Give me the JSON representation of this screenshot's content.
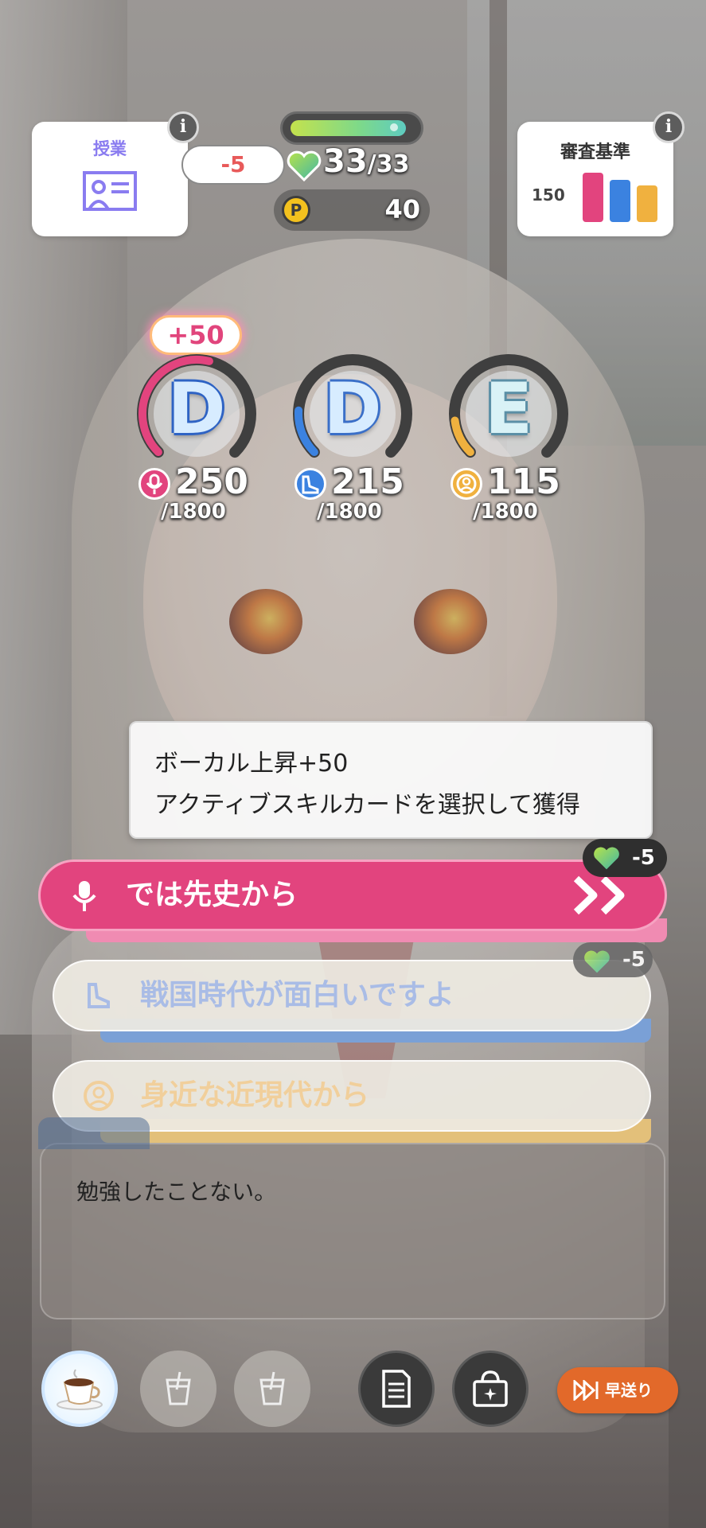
{
  "lesson": {
    "title": "授業",
    "icon": "teacher-board-icon"
  },
  "criteria": {
    "title": "審査基準",
    "value": "150",
    "bars": [
      {
        "color": "#e2447e",
        "level": 1.0
      },
      {
        "color": "#3b82e0",
        "level": 0.86
      },
      {
        "color": "#f0b13f",
        "level": 0.74
      }
    ]
  },
  "stamina": {
    "delta": "-5",
    "current": "33",
    "separator": "/",
    "max": "33",
    "fill_fraction": 0.94
  },
  "p_points": {
    "symbol": "P",
    "value": "40"
  },
  "stats": [
    {
      "grade": "D",
      "value": "250",
      "max": "/1800",
      "color": "#e2447e",
      "icon": "microphone-icon",
      "fill_fraction": 0.55
    },
    {
      "grade": "D",
      "value": "215",
      "max": "/1800",
      "color": "#3b82e0",
      "icon": "dance-shoe-icon",
      "fill_fraction": 0.18
    },
    {
      "grade": "E",
      "value": "115",
      "max": "/1800",
      "color": "#f0b13f",
      "icon": "visual-face-icon",
      "fill_fraction": 0.14
    }
  ],
  "stat_bonus": "+50",
  "tooltip": {
    "line1": "ボーカル上昇+50",
    "line2": "アクティブスキルカードを選択して獲得"
  },
  "choices": [
    {
      "label": "では先史から",
      "cost": "-5",
      "type": "vocal",
      "state": "selected"
    },
    {
      "label": "戦国時代が面白いですよ",
      "cost": "-5",
      "type": "dance",
      "state": "faded"
    },
    {
      "label": "身近な近現代から",
      "type": "visual",
      "state": "faded"
    }
  ],
  "dialogue": {
    "text": "勉強したことない。"
  },
  "bottom_bar": {
    "items": [
      "coffee-drink-icon",
      "empty-drink-slot-icon",
      "empty-drink-slot-icon",
      "memo-icon",
      "bag-icon"
    ],
    "fast_forward_label": "早送り"
  }
}
